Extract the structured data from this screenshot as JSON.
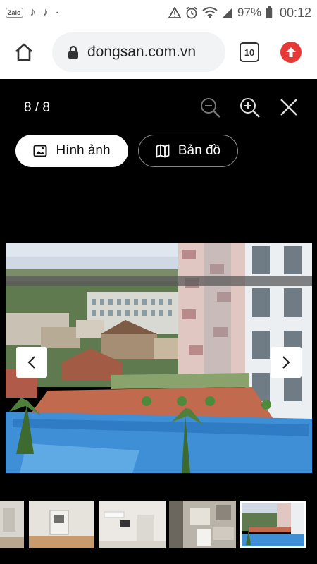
{
  "status_bar": {
    "app_icons": [
      "Zalo",
      "♪",
      "♪",
      "·"
    ],
    "battery": "97%",
    "time": "00:12"
  },
  "browser": {
    "url": "đongsan.com.vn",
    "tab_count": "10"
  },
  "viewer": {
    "counter": "8 / 8",
    "tabs": {
      "photos_label": "Hình ảnh",
      "map_label": "Bản đồ"
    },
    "current_index": 8,
    "total": 8
  },
  "colors": {
    "accent_red": "#e53935",
    "background": "#000000",
    "pill_active": "#ffffff"
  }
}
